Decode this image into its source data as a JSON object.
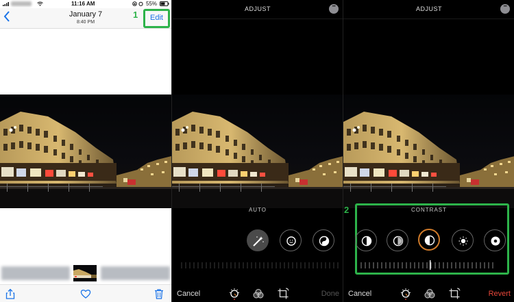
{
  "panel1": {
    "status_bar": {
      "time": "11:16 AM",
      "battery": "55%"
    },
    "nav": {
      "back_label": "<",
      "date": "January 7",
      "time": "8:40 PM",
      "edit_label": "Edit"
    },
    "step_badge": "1",
    "toolbar_icons": [
      "share-icon",
      "heart-icon",
      "trash-icon"
    ]
  },
  "panel2": {
    "title": "ADJUST",
    "tool_label": "AUTO",
    "tools": [
      "auto-wand-icon",
      "exposure-icon",
      "brilliance-icon"
    ],
    "cancel_label": "Cancel",
    "done_label": "Done"
  },
  "panel3": {
    "title": "ADJUST",
    "tool_label": "CONTRAST",
    "step_badge": "2",
    "tools": [
      "brilliance-icon",
      "highlights-icon",
      "contrast-icon",
      "brightness-icon",
      "black-point-icon"
    ],
    "cancel_label": "Cancel",
    "revert_label": "Revert"
  },
  "colors": {
    "accent_blue": "#1a73e8",
    "highlight_green": "#2db34a",
    "active_orange": "#d07b2a",
    "revert_red": "#e8473a"
  }
}
